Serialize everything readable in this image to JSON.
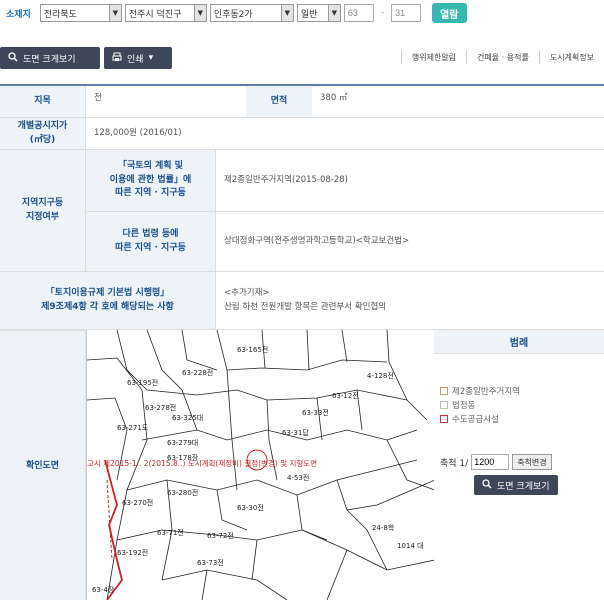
{
  "search": {
    "label": "소재지",
    "province": "전라북도",
    "district": "전주시 덕진구",
    "dong": "인후동2가",
    "lot_type": "일반",
    "main_no": "63",
    "dash": "-",
    "sub_no": "31",
    "view_button": "열람"
  },
  "toolbar": {
    "map_enlarge": "도면 크게보기",
    "print": "인쇄",
    "links": [
      "행위제한알림",
      "건폐율 · 용적률",
      "도시계획정보"
    ]
  },
  "info": {
    "jimok_label": "지목",
    "jimok_value": "전",
    "area_label": "면적",
    "area_value": "380 ㎡",
    "price_label": "개별공시지가\n(㎡당)",
    "price_value": "128,000원 (2016/01)",
    "zone_label": "지역지구등\n지정여부",
    "zone_sub1_label": "「국토의 계획 및\n이용에 관한 법률」에\n따른 지역 · 지구등",
    "zone_sub1_value": "제2종일반주거지역(2015-08-28)",
    "zone_sub2_label": "다른 법령 등에\n따른 지역 · 지구등",
    "zone_sub2_value": "상대정화구역(전주생명과학고등학교)<학교보건법>",
    "reg_label": "「토지이용규제 기본법 시행령」\n제9조제4항 각 호에 해당되는 사항",
    "reg_value1": "<추가기재>",
    "reg_value2": "산림 하천 전원개발 항목은 관련부서 확인협의",
    "map_label": "확인도면"
  },
  "map": {
    "parcels": [
      "63-165전",
      "63-228전",
      "63-278전",
      "63-325대",
      "63-279대",
      "63-270전",
      "63-271도",
      "63-280전",
      "63-71전",
      "63-72전",
      "63-73전",
      "63-30전",
      "63-192전",
      "63-4장",
      "4-128전",
      "4-53전",
      "24-8학",
      "1014 대",
      "63-33전",
      "63-31답",
      "63-178장",
      "63-195전",
      "63-12전"
    ],
    "notice": "고시 제2015-1.. 2(2015.8..) 도시계획(재정비) 결정(변경) 및 지형도면"
  },
  "legend": {
    "title": "범례",
    "items": [
      {
        "label": "제2종일반주거지역",
        "color": "#c8a070"
      },
      {
        "label": "법정동",
        "color": "#bbbbbb"
      },
      {
        "label": "수도공급시설",
        "color": "#cc3333"
      }
    ],
    "scale_label": "축척 1/",
    "scale_value": "1200",
    "scale_button": "축척변경",
    "enlarge_button": "도면 크게보기"
  }
}
